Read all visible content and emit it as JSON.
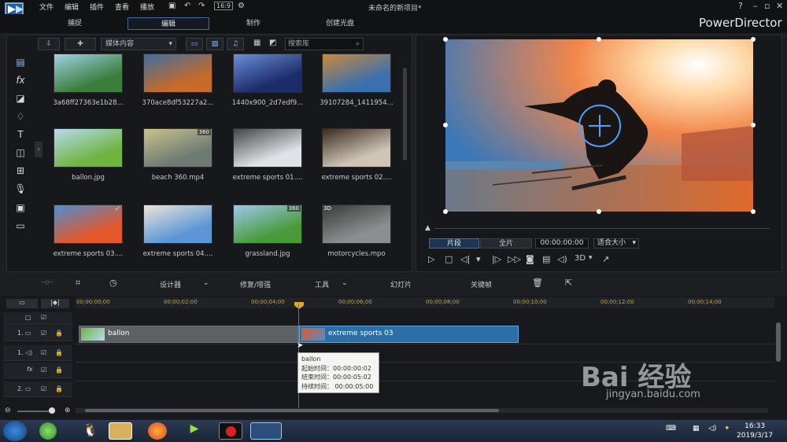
{
  "menu": [
    "文件",
    "编辑",
    "插件",
    "查看",
    "播放"
  ],
  "window_title": "未命名的新项目*",
  "mode_tabs": [
    "捕捉",
    "编辑",
    "制作",
    "创建光盘"
  ],
  "brand": "PowerDirector",
  "library": {
    "dropdown": "媒体内容",
    "search_placeholder": "搜索库",
    "items": [
      {
        "label": "3a68ff27363e1b28...",
        "colors": [
          "#3b7d3a",
          "#9ed1e6"
        ]
      },
      {
        "label": "370ace8df53227a2...",
        "colors": [
          "#c76a2a",
          "#3f6fa0"
        ]
      },
      {
        "label": "1440x900_2d7edf9...",
        "colors": [
          "#1c2b6a",
          "#6b8ed6"
        ]
      },
      {
        "label": "39107284_1411954...",
        "colors": [
          "#3a6fb0",
          "#c98a3b"
        ]
      },
      {
        "label": "ballon.jpg",
        "colors": [
          "#6fb43f",
          "#b8d9f2"
        ],
        "check": true
      },
      {
        "label": "beach 360.mp4",
        "colors": [
          "#6e7a74",
          "#c7c48b"
        ],
        "badge": "360"
      },
      {
        "label": "extreme sports 01....",
        "colors": [
          "#dfe3e8",
          "#444"
        ]
      },
      {
        "label": "extreme sports 02....",
        "colors": [
          "#cfc5b5",
          "#3a2b20"
        ]
      },
      {
        "label": "extreme sports 03....",
        "colors": [
          "#e3572a",
          "#4d8fd1"
        ],
        "check": true
      },
      {
        "label": "extreme sports 04....",
        "colors": [
          "#5c96d6",
          "#eae5d8"
        ]
      },
      {
        "label": "grassland.jpg",
        "colors": [
          "#4a9a3c",
          "#9ec7ee"
        ],
        "badge": "360"
      },
      {
        "label": "motorcycles.mpo",
        "colors": [
          "#8c8f90",
          "#3a3a3a"
        ],
        "badge3d": "3D"
      }
    ]
  },
  "preview": {
    "segment_tab": "片段",
    "full_tab": "全片",
    "timecode": "00:00:00:00",
    "fit": "适合大小",
    "three_d": "3D"
  },
  "edit_tools": {
    "designer": "设计器",
    "fix": "修复/增强",
    "tools": "工具",
    "slideshow": "幻灯片",
    "keyframe": "关键帧"
  },
  "timeline": {
    "ticks": [
      "00;00;00;00",
      "00;00;02;00",
      "00;00;04;00",
      "00;00;06;00",
      "00;00;08;00",
      "00;00;10;00",
      "00;00;12;00",
      "00;00;14;00"
    ],
    "track_labels": [
      "1.",
      "1.",
      "fx",
      "2."
    ],
    "clips": [
      {
        "name": "ballon"
      },
      {
        "name": "extreme sports 03"
      }
    ],
    "tooltip": {
      "title": "ballon",
      "start": "起始时间：00:00:00:02",
      "end": "结束时间：00:00:05:02",
      "duration": "持续时间：  00:00:05:00"
    }
  },
  "taskbar": {
    "time": "16:33",
    "date": "2019/3/17"
  },
  "watermark": "Bai 经验",
  "watermark_url": "jingyan.baidu.com",
  "colors": {
    "accent": "#3d6da3",
    "playhead": "#e04040",
    "clip_blue": "#2c6fa6"
  }
}
